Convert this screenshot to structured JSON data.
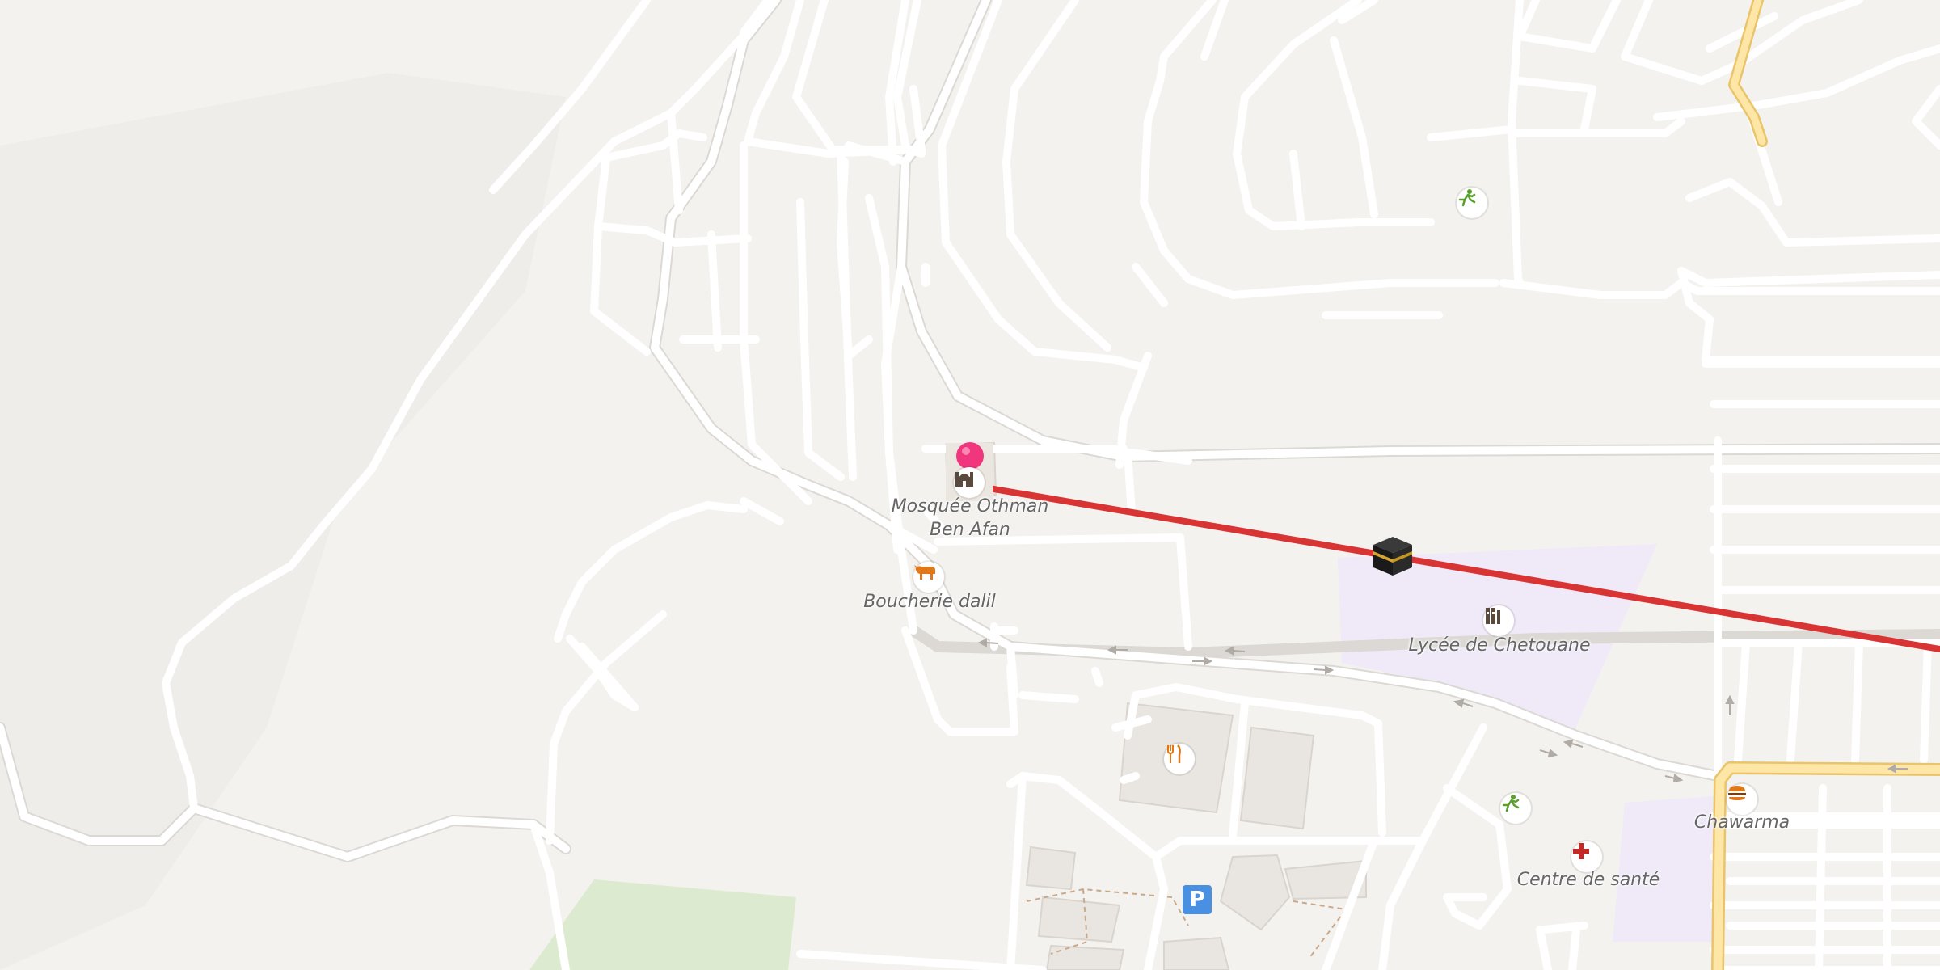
{
  "colors": {
    "background": "#f4f2ef",
    "road": "#ffffff",
    "road_casing": "#dcd9d5",
    "major_road": "#fde6a6",
    "major_road_casing": "#e9c46a",
    "route_line": "#d93434",
    "school_area": "#efe9f8",
    "park_area": "#dcebcf",
    "building": "#e9e5e0",
    "pin": "#f0367c",
    "parking": "#4a90e2",
    "label_text": "#666666"
  },
  "map": {
    "labels": {
      "mosque_line1": "Mosquée Othman",
      "mosque_line2": "Ben Afan",
      "butcher": "Boucherie dalil",
      "school": "Lycée de Chetouane",
      "shawarma": "Chawarma",
      "health_center": "Centre de santé",
      "parking": "P"
    },
    "icons": [
      "location-pin-icon",
      "mosque-icon",
      "kaaba-icon",
      "butcher-icon",
      "school-icon",
      "sports-icon",
      "restaurant-icon",
      "fast-food-icon",
      "health-cross-icon",
      "parking-icon"
    ]
  }
}
